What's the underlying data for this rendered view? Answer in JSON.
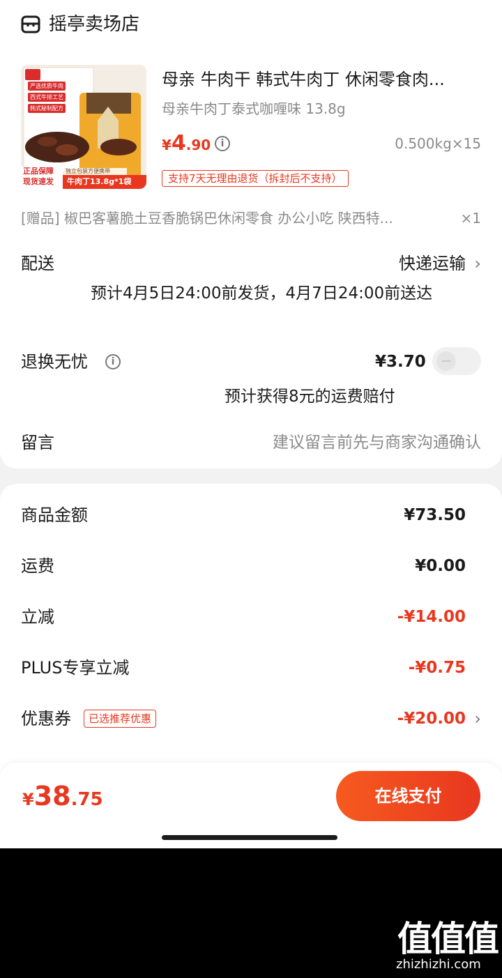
{
  "store": {
    "name": "摇亭卖场店",
    "icon": "store-icon"
  },
  "product": {
    "title": "母亲 牛肉干 韩式牛肉丁 休闲零食肉...",
    "spec": "母亲牛肉丁泰式咖喱味 13.8g",
    "price_symbol": "¥",
    "price_int": "4",
    "price_dec": ".90",
    "quantity": "0.500kg×15",
    "return_policy": "支持7天无理由退货（拆封后不支持）",
    "image": {
      "badges": [
        "严选优质牛肉",
        "西式牛排工艺",
        "韩式秘制配方"
      ],
      "guarantee_1": "正品保障",
      "guarantee_2": "现货速发",
      "pack_note": "独立包装方便携带",
      "pack_label": "牛肉丁13.8g*1袋"
    }
  },
  "gift": {
    "text": "[赠品] 椒巴客薯脆土豆香脆锅巴休闲零食 办公小吃 陕西特...",
    "qty": "×1"
  },
  "delivery": {
    "label": "配送",
    "method": "快递运输",
    "estimate": "预计4月5日24:00前发货，4月7日24:00前送达"
  },
  "return_insurance": {
    "label": "退换无忧",
    "price": "¥3.70",
    "compensation": "预计获得8元的运费赔付",
    "enabled": false
  },
  "note": {
    "label": "留言",
    "placeholder": "建议留言前先与商家沟通确认"
  },
  "summary": {
    "goods_label": "商品金额",
    "goods_value": "¥73.50",
    "shipping_label": "运费",
    "shipping_value": "¥0.00",
    "discount_label": "立减",
    "discount_value": "-¥14.00",
    "plus_label": "PLUS专享立减",
    "plus_value": "-¥0.75",
    "coupon_label": "优惠券",
    "coupon_tag": "已选推荐优惠",
    "coupon_value": "-¥20.00"
  },
  "footer": {
    "total_symbol": "¥",
    "total_int": "38",
    "total_dec": ".75",
    "pay_label": "在线支付"
  },
  "watermark": {
    "logo": "值值值",
    "site": "zhizhizhi.com"
  },
  "colors": {
    "accent": "#e8371f",
    "muted": "#8a8a8a",
    "text": "#1a1a1a",
    "background": "#f2f2f2"
  }
}
